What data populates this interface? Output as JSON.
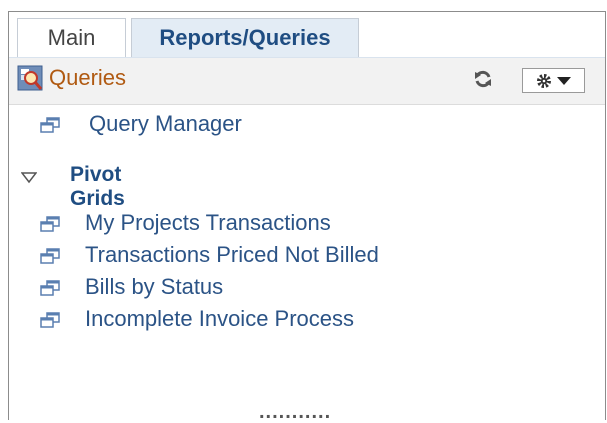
{
  "tabs": [
    {
      "label": "Main",
      "active": false
    },
    {
      "label": "Reports/Queries",
      "active": true
    }
  ],
  "pagelet": {
    "title": "Queries",
    "icon": "query-search-icon",
    "actions": [
      "refresh-icon",
      "gear-menu-icon"
    ]
  },
  "items": {
    "query_manager": "Query Manager",
    "group": {
      "label": "Pivot Grids",
      "expanded": true,
      "items": [
        "My Projects Transactions",
        "Transactions Priced Not Billed",
        "Bills by Status",
        "Incomplete Invoice Process"
      ]
    }
  },
  "footer": {
    "resize_handle": "..........."
  },
  "colors": {
    "title": "#b05a12",
    "link": "#2b5386",
    "active_tab_bg": "#e3ecf5",
    "header_bg": "#f2f2f2"
  }
}
